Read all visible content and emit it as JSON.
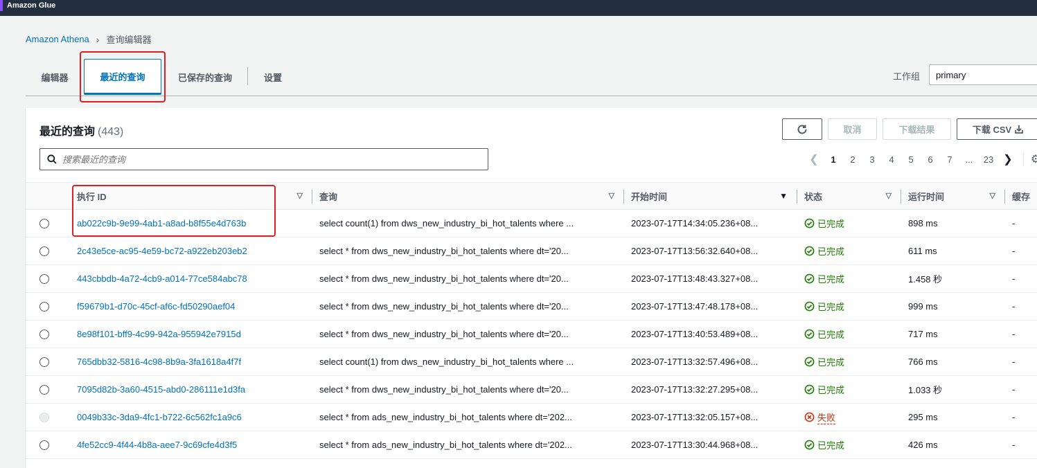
{
  "topbar": {
    "title": "Amazon Glue"
  },
  "breadcrumb": {
    "root": "Amazon Athena",
    "current": "查询编辑器"
  },
  "tabs": [
    {
      "label": "编辑器"
    },
    {
      "label": "最近的查询"
    },
    {
      "label": "已保存的查询"
    },
    {
      "label": "设置"
    }
  ],
  "workgroup": {
    "label": "工作组",
    "value": "primary"
  },
  "panel": {
    "title": "最近的查询",
    "count": "(443)",
    "cancel_label": "取消",
    "download_label": "下载结果",
    "csv_label": "下载 CSV",
    "search_placeholder": "搜索最近的查询"
  },
  "pagination": {
    "pages": [
      "1",
      "2",
      "3",
      "4",
      "5",
      "6",
      "7",
      "...",
      "23"
    ],
    "current": "1"
  },
  "columns": {
    "id": "执行 ID",
    "query": "查询",
    "start": "开始时间",
    "status": "状态",
    "runtime": "运行时间",
    "cache": "缓存"
  },
  "rows": [
    {
      "id": "ab022c9b-9e99-4ab1-a8ad-b8f55e4d763b",
      "query": "select count(1) from dws_new_industry_bi_hot_talents where ...",
      "start": "2023-07-17T14:34:05.236+08...",
      "status": "已完成",
      "ok": true,
      "runtime": "898 ms",
      "cache": "-"
    },
    {
      "id": "2c43e5ce-ac95-4e59-bc72-a922eb203eb2",
      "query": "select * from dws_new_industry_bi_hot_talents where dt='20...",
      "start": "2023-07-17T13:56:32.640+08...",
      "status": "已完成",
      "ok": true,
      "runtime": "611 ms",
      "cache": "-"
    },
    {
      "id": "443cbbdb-4a72-4cb9-a014-77ce584abc78",
      "query": "select * from dws_new_industry_bi_hot_talents where dt='20...",
      "start": "2023-07-17T13:48:43.327+08...",
      "status": "已完成",
      "ok": true,
      "runtime": "1.458 秒",
      "cache": "-"
    },
    {
      "id": "f59679b1-d70c-45cf-af6c-fd50290aef04",
      "query": "select * from dws_new_industry_bi_hot_talents where dt='20...",
      "start": "2023-07-17T13:47:48.178+08...",
      "status": "已完成",
      "ok": true,
      "runtime": "999 ms",
      "cache": "-"
    },
    {
      "id": "8e98f101-bff9-4c99-942a-955942e7915d",
      "query": "select * from dws_new_industry_bi_hot_talents where dt='20...",
      "start": "2023-07-17T13:40:53.489+08...",
      "status": "已完成",
      "ok": true,
      "runtime": "717 ms",
      "cache": "-"
    },
    {
      "id": "765dbb32-5816-4c98-8b9a-3fa1618a4f7f",
      "query": "select count(1) from dws_new_industry_bi_hot_talents where ...",
      "start": "2023-07-17T13:32:57.496+08...",
      "status": "已完成",
      "ok": true,
      "runtime": "766 ms",
      "cache": "-"
    },
    {
      "id": "7095d82b-3a60-4515-abd0-286111e1d3fa",
      "query": "select * from dws_new_industry_bi_hot_talents where dt='20...",
      "start": "2023-07-17T13:32:27.295+08...",
      "status": "已完成",
      "ok": true,
      "runtime": "1.033 秒",
      "cache": "-"
    },
    {
      "id": "0049b33c-3da9-4fc1-b722-6c562fc1a9c6",
      "query": "select * from ads_new_industry_bi_hot_talents where dt='202...",
      "start": "2023-07-17T13:32:05.157+08...",
      "status": "失败",
      "ok": false,
      "runtime": "295 ms",
      "cache": "-"
    },
    {
      "id": "4fe52cc9-4f44-4b8a-aee7-9c69cfe4d3f5",
      "query": "select * from ads_new_industry_bi_hot_talents where dt='202...",
      "start": "2023-07-17T13:30:44.968+08...",
      "status": "已完成",
      "ok": true,
      "runtime": "426 ms",
      "cache": "-"
    }
  ]
}
